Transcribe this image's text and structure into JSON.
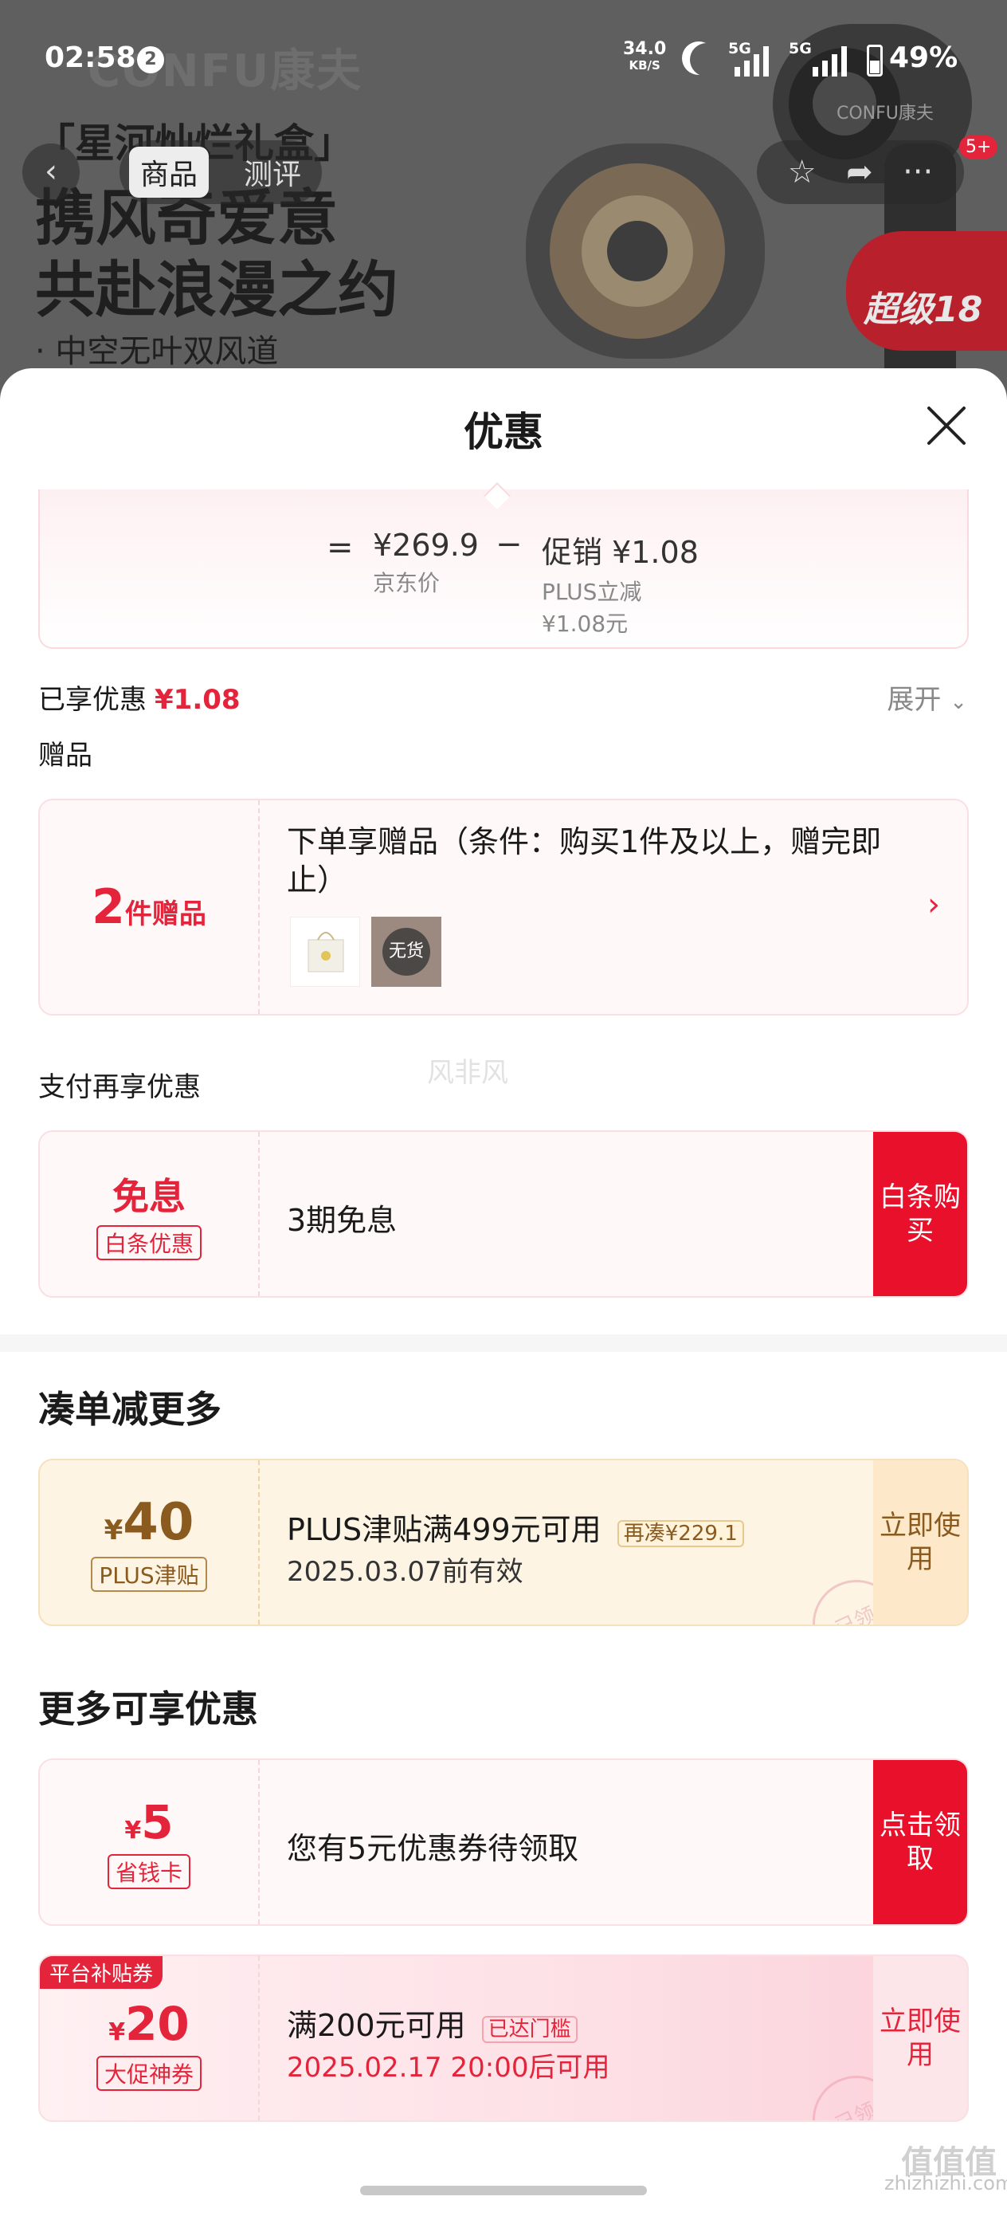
{
  "status_bar": {
    "time": "02:58",
    "notifications": "2",
    "speed_value": "34.0",
    "speed_unit": "KB/S",
    "sim1": "5G",
    "sim2": "5G",
    "battery": "49%"
  },
  "background": {
    "brand": "CONFU康夫",
    "headline_1": "「星河灿烂礼盒」",
    "headline_2": "携风奇爱意",
    "headline_3": "共赴浪漫之约",
    "headline_4": "· 中空无叶双风道",
    "product_brand": "CONFU康夫",
    "promo_tag": "超级18"
  },
  "nav": {
    "tabs": [
      "商品",
      "测评"
    ],
    "active_tab": "商品",
    "cart_badge": "5+"
  },
  "sheet": {
    "title": "优惠",
    "calc": {
      "eq": "=",
      "price": "¥269.9",
      "price_label": "京东价",
      "minus": "−",
      "promo": "促销 ¥1.08",
      "promo_sub1": "PLUS立减",
      "promo_sub2": "¥1.08元"
    },
    "enjoyed_label": "已享优惠",
    "enjoyed_value": "¥1.08",
    "expand_label": "展开",
    "gift_section": "赠品",
    "gift_card": {
      "count": "2",
      "count_unit": "件赠品",
      "desc": "下单享赠品（条件：购买1件及以上，赠完即止）",
      "out_of_stock": "无货"
    },
    "pay_section": "支付再享优惠",
    "pay_card": {
      "title": "免息",
      "tag": "白条优惠",
      "desc": "3期免息",
      "button": "白条购买"
    },
    "bundle_section": "凑单减更多",
    "plus_card": {
      "currency": "¥",
      "amount": "40",
      "tag": "PLUS津贴",
      "title": "PLUS津贴满499元可用",
      "extra": "再凑¥229.1",
      "validity": "2025.03.07前有效",
      "button": "立即使用",
      "stamp": "已领"
    },
    "more_section": "更多可享优惠",
    "saver_card": {
      "currency": "¥",
      "amount": "5",
      "tag": "省钱卡",
      "desc": "您有5元优惠券待领取",
      "button": "点击领取"
    },
    "platform_card": {
      "corner": "平台补贴券",
      "currency": "¥",
      "amount": "20",
      "tag": "大促神券",
      "title": "满200元可用",
      "reached": "已达门槛",
      "time": "2025.02.17 20:00后可用",
      "button": "立即使用",
      "stamp": "已领"
    }
  },
  "overlay_watermark": "风非风",
  "site_watermark": {
    "logo": "值值值",
    "url": "zhizhizhi.com"
  },
  "colors": {
    "accent": "#e4243b",
    "button_red": "#e8102a",
    "plus_gold": "#8a5a1e"
  }
}
